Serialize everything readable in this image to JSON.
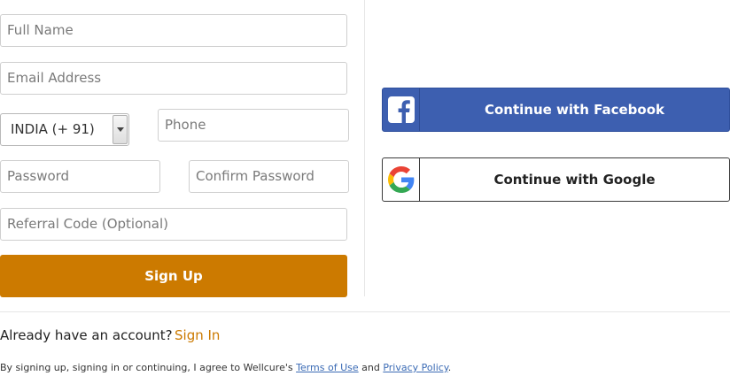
{
  "form": {
    "full_name": {
      "placeholder": "Full Name"
    },
    "email": {
      "placeholder": "Email Address"
    },
    "country_code": {
      "selected": "INDIA (+ 91)"
    },
    "phone": {
      "placeholder": "Phone"
    },
    "password": {
      "placeholder": "Password"
    },
    "confirm_password": {
      "placeholder": "Confirm Password"
    },
    "referral": {
      "placeholder": "Referral Code (Optional)"
    },
    "signup_label": "Sign Up"
  },
  "social": {
    "facebook_label": "Continue with Facebook",
    "google_label": "Continue with Google",
    "facebook_icon": "facebook-icon",
    "google_icon": "google-icon"
  },
  "footer": {
    "already_text": "Already have an account?",
    "signin_label": "Sign In",
    "terms_prefix": "By signing up, signing in or continuing, I agree to Wellcure's",
    "terms_link": "Terms of Use",
    "terms_and": "and",
    "privacy_link": "Privacy Policy",
    "terms_suffix": "."
  },
  "colors": {
    "accent": "#cc7a00",
    "facebook": "#3d5fb0",
    "link": "#3b6bb5"
  }
}
